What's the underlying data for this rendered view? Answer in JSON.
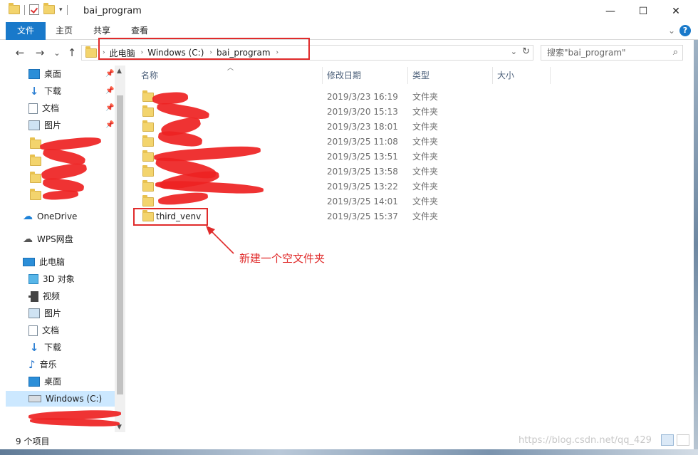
{
  "window": {
    "title": "bai_program"
  },
  "title_controls": {
    "minimize": "—",
    "maximize": "☐",
    "close": "✕"
  },
  "ribbon": {
    "tabs": [
      "文件",
      "主页",
      "共享",
      "查看"
    ],
    "expand": "⌄",
    "help": "?"
  },
  "nav": {
    "back": "←",
    "forward": "→",
    "recent": "⌄",
    "up": "↑"
  },
  "address": {
    "crumbs": [
      "此电脑",
      "Windows (C:)",
      "bai_program"
    ],
    "separator": "›",
    "dropdown": "⌄",
    "refresh": "↻"
  },
  "search": {
    "placeholder": "搜索\"bai_program\"",
    "icon": "⌕"
  },
  "sidebar": {
    "quick": [
      {
        "label": "桌面",
        "icon": "desktop-icon",
        "pinned": true
      },
      {
        "label": "下载",
        "icon": "download-icon",
        "pinned": true
      },
      {
        "label": "文档",
        "icon": "document-icon",
        "pinned": true
      },
      {
        "label": "图片",
        "icon": "picture-icon",
        "pinned": true
      }
    ],
    "onedrive": "OneDrive",
    "wps": "WPS网盘",
    "thispc": "此电脑",
    "pc_items": [
      {
        "label": "3D 对象",
        "icon": "3d-objects-icon"
      },
      {
        "label": "视频",
        "icon": "video-icon"
      },
      {
        "label": "图片",
        "icon": "picture-icon"
      },
      {
        "label": "文档",
        "icon": "document-icon"
      },
      {
        "label": "下载",
        "icon": "download-icon"
      },
      {
        "label": "音乐",
        "icon": "music-icon"
      },
      {
        "label": "桌面",
        "icon": "desktop-icon"
      }
    ],
    "selected_drive": "Windows (C:)",
    "pin_glyph": "📌"
  },
  "columns": {
    "name": "名称",
    "date": "修改日期",
    "type": "类型",
    "size": "大小"
  },
  "files": [
    {
      "name": "",
      "date": "2019/3/23 16:19",
      "type": "文件夹"
    },
    {
      "name": "",
      "date": "2019/3/20 15:13",
      "type": "文件夹"
    },
    {
      "name": "",
      "date": "2019/3/23 18:01",
      "type": "文件夹"
    },
    {
      "name": "",
      "date": "2019/3/25 11:08",
      "type": "文件夹"
    },
    {
      "name": "",
      "date": "2019/3/25 13:51",
      "type": "文件夹"
    },
    {
      "name": "",
      "date": "2019/3/25 13:58",
      "type": "文件夹"
    },
    {
      "name": "",
      "date": "2019/3/25 13:22",
      "type": "文件夹"
    },
    {
      "name": "",
      "date": "2019/3/25 14:01",
      "type": "文件夹"
    },
    {
      "name": "third_venv",
      "date": "2019/3/25 15:37",
      "type": "文件夹"
    }
  ],
  "annotation": {
    "text": "新建一个空文件夹",
    "color": "#e02b2b"
  },
  "status": {
    "count": "9 个项目"
  },
  "watermark": "https://blog.csdn.net/qq_429",
  "colors": {
    "accent": "#1979ca",
    "selection": "#cce8ff",
    "annotation_red": "#e02b2b",
    "folder": "#f3d46d"
  }
}
